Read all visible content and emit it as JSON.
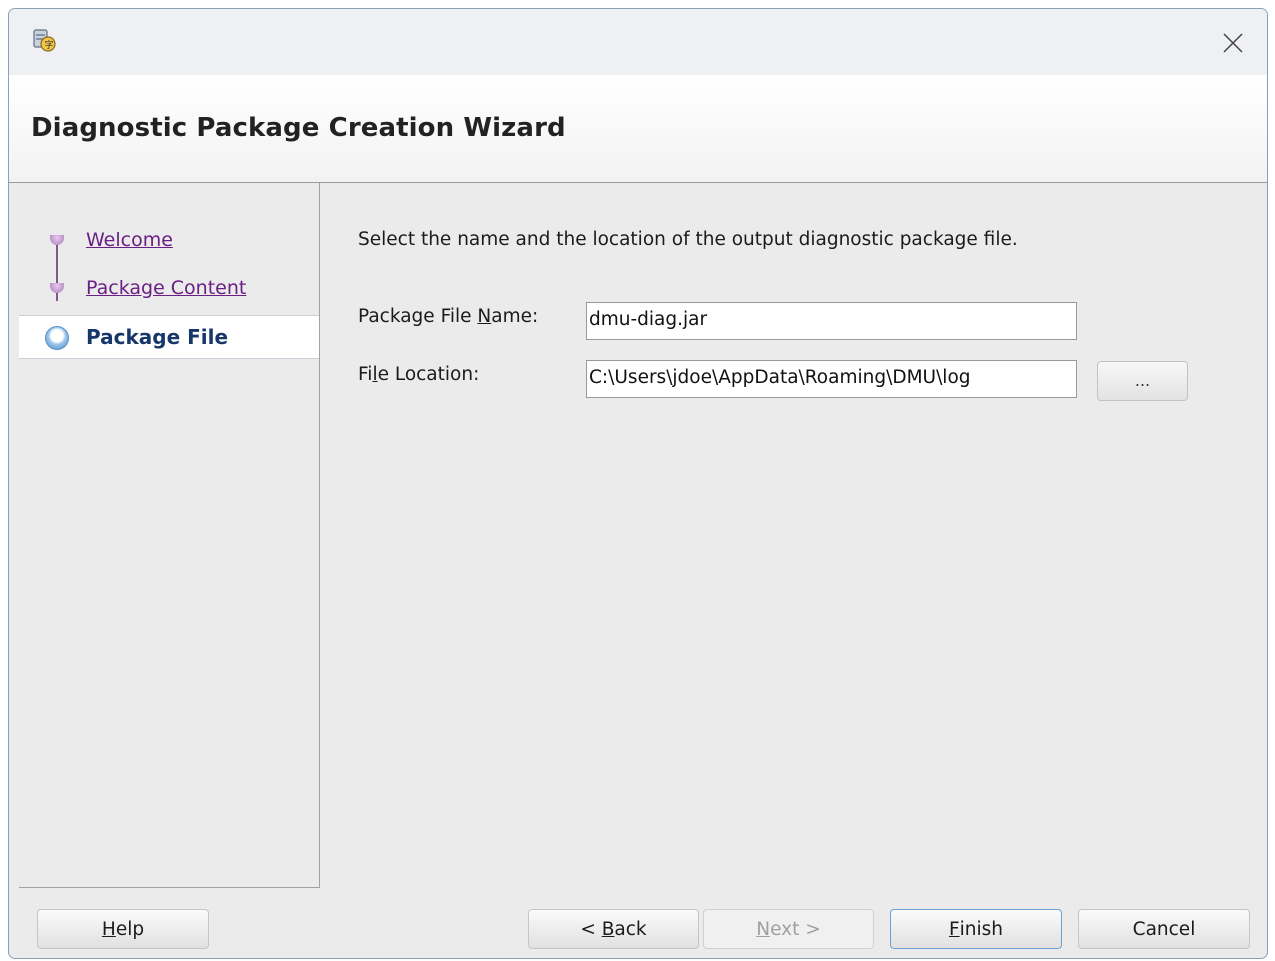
{
  "window": {
    "icon": "database-app-icon",
    "close_icon": "close-icon"
  },
  "header": {
    "title": "Diagnostic Package Creation Wizard"
  },
  "steps": [
    {
      "label": "Welcome",
      "state": "visited"
    },
    {
      "label": "Package Content",
      "state": "visited"
    },
    {
      "label": "Package File",
      "state": "current"
    }
  ],
  "content": {
    "instruction": "Select the name and the location of the output diagnostic package file.",
    "package_file_name": {
      "label_before": "Package File ",
      "label_mnemonic": "N",
      "label_after": "ame:",
      "value": "dmu-diag.jar"
    },
    "file_location": {
      "label_before": "Fi",
      "label_mnemonic": "l",
      "label_after": "e Location:",
      "value": "C:\\Users\\jdoe\\AppData\\Roaming\\DMU\\log",
      "browse_label": "..."
    }
  },
  "buttons": {
    "help": {
      "mnemonic": "H",
      "rest": "elp"
    },
    "back": {
      "before": "< ",
      "mnemonic": "B",
      "rest": "ack"
    },
    "next": {
      "mnemonic": "N",
      "rest": "ext >"
    },
    "finish": {
      "mnemonic": "F",
      "rest": "inish"
    },
    "cancel": {
      "label": "Cancel"
    }
  },
  "colors": {
    "link": "#6a1f84",
    "active_step": "#17376b",
    "accent": "#4c8ac6"
  }
}
